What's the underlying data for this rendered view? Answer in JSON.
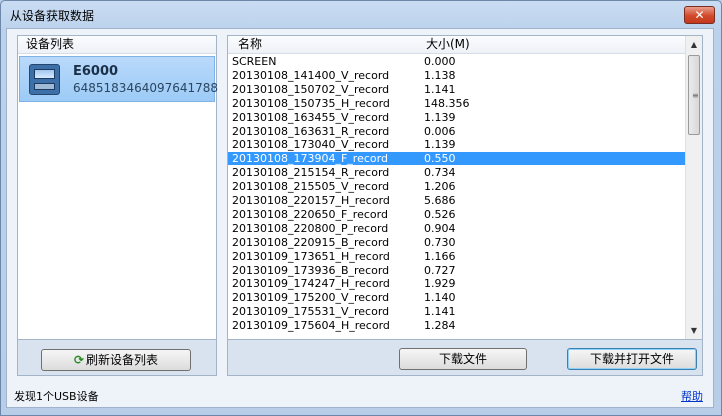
{
  "window": {
    "title": "从设备获取数据",
    "close_label": "✕"
  },
  "device_panel": {
    "header": "设备列表",
    "devices": [
      {
        "name": "E6000",
        "serial": "6485183464097641788",
        "icon": "device-icon"
      }
    ],
    "refresh_label": "刷新设备列表",
    "refresh_icon": "refresh-icon"
  },
  "file_panel": {
    "col_name": "名称",
    "col_size": "大小(M)",
    "selected_index": 7,
    "files": [
      {
        "name": "SCREEN",
        "size": "0.000"
      },
      {
        "name": "20130108_141400_V_record",
        "size": "1.138"
      },
      {
        "name": "20130108_150702_V_record",
        "size": "1.141"
      },
      {
        "name": "20130108_150735_H_record",
        "size": "148.356"
      },
      {
        "name": "20130108_163455_V_record",
        "size": "1.139"
      },
      {
        "name": "20130108_163631_R_record",
        "size": "0.006"
      },
      {
        "name": "20130108_173040_V_record",
        "size": "1.139"
      },
      {
        "name": "20130108_173904_F_record",
        "size": "0.550"
      },
      {
        "name": "20130108_215154_R_record",
        "size": "0.734"
      },
      {
        "name": "20130108_215505_V_record",
        "size": "1.206"
      },
      {
        "name": "20130108_220157_H_record",
        "size": "5.686"
      },
      {
        "name": "20130108_220650_F_record",
        "size": "0.526"
      },
      {
        "name": "20130108_220800_P_record",
        "size": "0.904"
      },
      {
        "name": "20130108_220915_B_record",
        "size": "0.730"
      },
      {
        "name": "20130109_173651_H_record",
        "size": "1.166"
      },
      {
        "name": "20130109_173936_B_record",
        "size": "0.727"
      },
      {
        "name": "20130109_174247_H_record",
        "size": "1.929"
      },
      {
        "name": "20130109_175200_V_record",
        "size": "1.140"
      },
      {
        "name": "20130109_175531_V_record",
        "size": "1.141"
      },
      {
        "name": "20130109_175604_H_record",
        "size": "1.284"
      }
    ],
    "scroll_up": "▲",
    "scroll_down": "▼",
    "grip": "≡"
  },
  "buttons": {
    "download": "下载文件",
    "download_open": "下载并打开文件"
  },
  "status": "发现1个USB设备",
  "help": "帮助",
  "colors": {
    "selection": "#3399ff",
    "close_button": "#d24a2a",
    "link": "#0033cc"
  }
}
